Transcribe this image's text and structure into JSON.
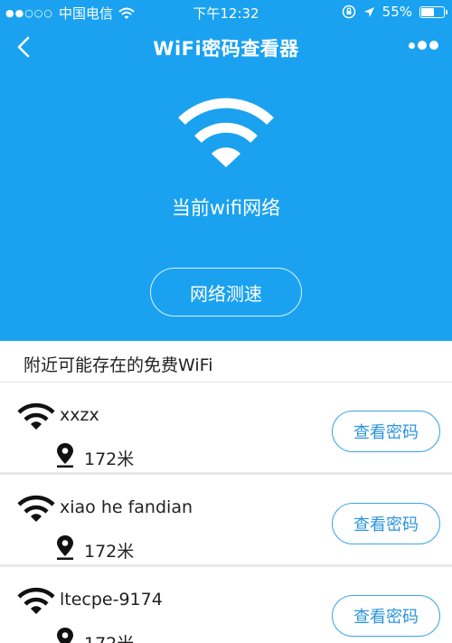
{
  "status_bar": {
    "signal_dots": "●●○○○",
    "carrier": "中国电信",
    "time": "下午12:32",
    "battery_percent": "55%",
    "battery_level": 0.55
  },
  "nav": {
    "title": "WiFi密码查看器"
  },
  "hero": {
    "current_network_label": "当前wifi网络",
    "speed_test_label": "网络测速"
  },
  "section": {
    "title": "附近可能存在的免费WiFi"
  },
  "wifi_list": [
    {
      "name": "xxzx",
      "distance": "172米",
      "button_label": "查看密码"
    },
    {
      "name": "xiao he fandian",
      "distance": "172米",
      "button_label": "查看密码"
    },
    {
      "name": "ltecpe-9174",
      "distance": "172米",
      "button_label": "查看密码"
    }
  ],
  "colors": {
    "hero_bg": "#1aa2f0",
    "button_accent": "#2a95dc"
  }
}
